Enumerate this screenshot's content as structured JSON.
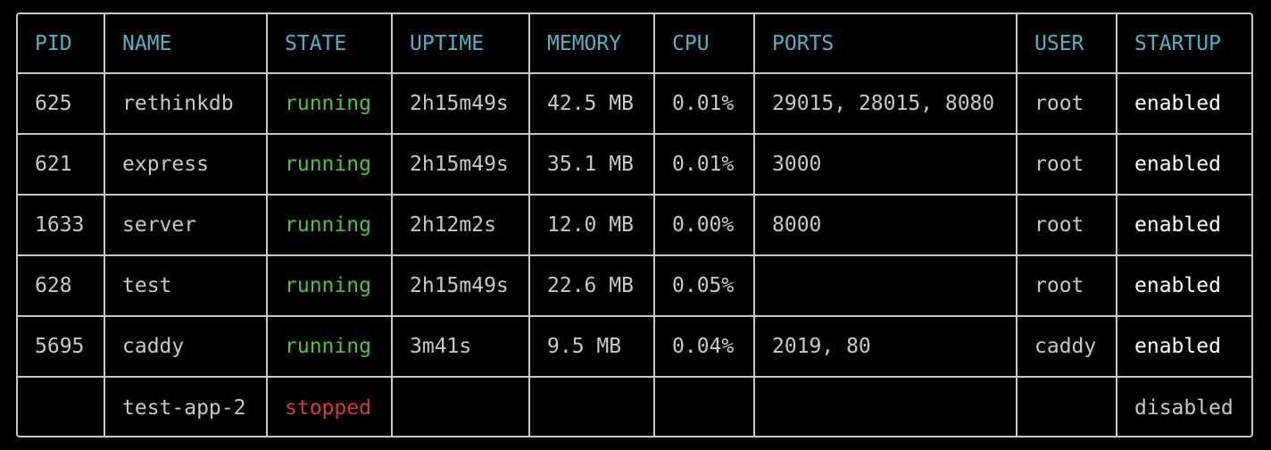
{
  "columns": {
    "pid": "PID",
    "name": "NAME",
    "state": "STATE",
    "uptime": "UPTIME",
    "memory": "MEMORY",
    "cpu": "CPU",
    "ports": "PORTS",
    "user": "USER",
    "startup": "STARTUP"
  },
  "colors": {
    "border": "#c8c8c8",
    "header": "#4fb3c4",
    "running": "#4ec43a",
    "stopped": "#d0402a",
    "enabled": "#ffffff",
    "text": "#c8c8c8"
  },
  "rows": [
    {
      "pid": "625",
      "name": "rethinkdb",
      "state": "running",
      "uptime": "2h15m49s",
      "memory": "42.5 MB",
      "cpu": "0.01%",
      "ports": "29015, 28015, 8080",
      "user": "root",
      "startup": "enabled"
    },
    {
      "pid": "621",
      "name": "express",
      "state": "running",
      "uptime": "2h15m49s",
      "memory": "35.1 MB",
      "cpu": "0.01%",
      "ports": "3000",
      "user": "root",
      "startup": "enabled"
    },
    {
      "pid": "1633",
      "name": "server",
      "state": "running",
      "uptime": "2h12m2s",
      "memory": "12.0 MB",
      "cpu": "0.00%",
      "ports": "8000",
      "user": "root",
      "startup": "enabled"
    },
    {
      "pid": "628",
      "name": "test",
      "state": "running",
      "uptime": "2h15m49s",
      "memory": "22.6 MB",
      "cpu": "0.05%",
      "ports": "",
      "user": "root",
      "startup": "enabled"
    },
    {
      "pid": "5695",
      "name": "caddy",
      "state": "running",
      "uptime": "3m41s",
      "memory": "9.5 MB",
      "cpu": "0.04%",
      "ports": "2019, 80",
      "user": "caddy",
      "startup": "enabled"
    },
    {
      "pid": "",
      "name": "test-app-2",
      "state": "stopped",
      "uptime": "",
      "memory": "",
      "cpu": "",
      "ports": "",
      "user": "",
      "startup": "disabled"
    }
  ]
}
